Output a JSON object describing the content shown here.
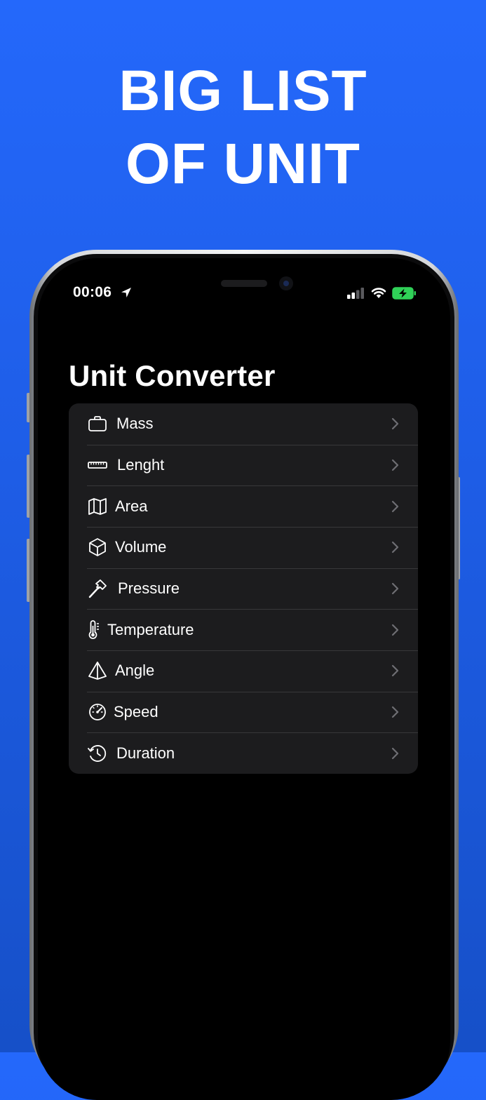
{
  "headline": {
    "line1": "BIG LIST",
    "line2": "OF UNIT"
  },
  "status_bar": {
    "time": "00:06",
    "icons": [
      "location-arrow-icon",
      "cellular-signal-icon",
      "wifi-icon",
      "battery-charging-icon"
    ],
    "battery_color": "#30d158"
  },
  "screen": {
    "title": "Unit Converter",
    "items": [
      {
        "label": "Mass",
        "icon": "briefcase-icon"
      },
      {
        "label": "Lenght",
        "icon": "ruler-icon"
      },
      {
        "label": "Area",
        "icon": "map-icon"
      },
      {
        "label": "Volume",
        "icon": "cube-icon"
      },
      {
        "label": "Pressure",
        "icon": "hammer-icon"
      },
      {
        "label": "Temperature",
        "icon": "thermometer-icon"
      },
      {
        "label": "Angle",
        "icon": "pyramid-icon"
      },
      {
        "label": "Speed",
        "icon": "speedometer-icon"
      },
      {
        "label": "Duration",
        "icon": "clock-arrow-icon"
      }
    ]
  },
  "colors": {
    "background_top": "#2468fb",
    "background_bottom": "#1650c8",
    "list_background": "#1c1c1e",
    "separator": "#38383a",
    "chevron": "#6e6e73"
  }
}
